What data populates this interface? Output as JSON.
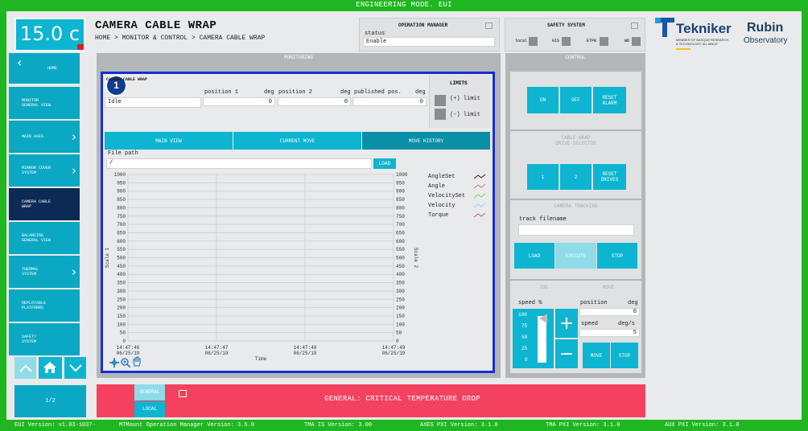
{
  "top_banner": "ENGINEERING MODE. EUI",
  "temperature": "15.0 c",
  "title": "CAMERA CABLE WRAP",
  "breadcrumb": "HOME > MONITOR & CONTROL > CAMERA CABLE WRAP",
  "op_manager": {
    "title": "OPERATION MANAGER",
    "status_label": "status",
    "status_value": "Enable"
  },
  "safety": {
    "title": "SAFETY SYSTEM",
    "items": [
      "local",
      "GIS",
      "ETPB",
      "WD"
    ]
  },
  "logos": {
    "tekniker": "Tekniker",
    "tekniker_sub1": "MEMBER OF BASQUE RESEARCH",
    "tekniker_sub2": "& TECHNOLOGY ALLIANCE",
    "rubin1": "Rubin",
    "rubin2": "Observatory"
  },
  "sidebar": {
    "home": "HOME",
    "items": [
      {
        "label1": "MONITOR",
        "label2": "GENERAL VIEW"
      },
      {
        "label1": "MAIN AXES",
        "label2": ""
      },
      {
        "label1": "MIRROR COVER",
        "label2": "SYSTEM"
      },
      {
        "label1": "CAMERA CABLE",
        "label2": "WRAP"
      },
      {
        "label1": "BALANCING",
        "label2": "GENERAL VIEW"
      },
      {
        "label1": "THERMAL",
        "label2": "SYSTEM"
      },
      {
        "label1": "DEPLOYABLE",
        "label2": "PLATFORMS"
      },
      {
        "label1": "SAFETY",
        "label2": "SYSTEM"
      }
    ],
    "page": "1/2"
  },
  "monitoring": {
    "header": "MONITORING",
    "badge": "1",
    "subtitle": "CAMERA CABLE WRAP",
    "state": "Idle",
    "pos1_label": "position 1",
    "pos1_unit": "deg",
    "pos1_value": "0",
    "pos2_label": "position 2",
    "pos2_unit": "deg",
    "pos2_value": "0",
    "pub_label": "published pos.",
    "pub_unit": "deg",
    "pub_value": "0",
    "limits_title": "LIMITS",
    "limit_plus": "(+) limit",
    "limit_minus": "(-) limit",
    "tabs": [
      "MAIN VIEW",
      "CURRENT MOVE",
      "MOVE HISTORY"
    ],
    "file_path_label": "File path",
    "file_path_value": "/",
    "load": "LOAD"
  },
  "chart_data": {
    "type": "line",
    "xlabel": "Time",
    "ylabel": "Scale 1",
    "ylabel2": "Scale 2",
    "ylim": [
      0,
      1000
    ],
    "yticks": [
      "1000",
      "950",
      "900",
      "850",
      "800",
      "750",
      "700",
      "650",
      "600",
      "550",
      "500",
      "450",
      "400",
      "350",
      "300",
      "250",
      "200",
      "150",
      "100",
      "50",
      "0"
    ],
    "xticks": [
      {
        "time": "14:47:46",
        "date": "06/25/19"
      },
      {
        "time": "14:47:47",
        "date": "06/25/19"
      },
      {
        "time": "14:47:48",
        "date": "06/25/19"
      },
      {
        "time": "14:47:49",
        "date": "06/25/19"
      }
    ],
    "series": [
      {
        "name": "AngleSet",
        "color": "#222222",
        "values": []
      },
      {
        "name": "Angle",
        "color": "#e8707a",
        "values": []
      },
      {
        "name": "VelocitySet",
        "color": "#79d36b",
        "values": []
      },
      {
        "name": "Velocity",
        "color": "#8fd8e6",
        "values": []
      },
      {
        "name": "Torque",
        "color": "#c0607a",
        "values": []
      }
    ],
    "grid": true
  },
  "control": {
    "header": "CONTROL",
    "on": "ON",
    "off": "OFF",
    "reset_alarm": "RESET ALARM",
    "drive_title1": "CABLE WRAP",
    "drive_title2": "DRIVE SELECTOR",
    "d1": "1",
    "d2": "2",
    "reset_drives": "RESET DRIVES",
    "tracking_title": "CAMERA TRACKING",
    "track_label": "track filename",
    "load": "LOAD",
    "execute": "EXECUTE",
    "stop": "STOP",
    "jog": "JOG",
    "move": "MOVE",
    "speed_pct_label": "speed %",
    "speed_ticks": [
      "100",
      "75",
      "50",
      "25",
      "0"
    ],
    "position_label": "position",
    "position_unit": "deg",
    "position_value": "0",
    "speed_label": "speed",
    "speed_unit": "deg/s",
    "speed_value": "5",
    "move_btn": "MOVE",
    "stop_btn": "STOP"
  },
  "alarm": {
    "general": "GENERAL",
    "local": "LOCAL",
    "message": "GENERAL: CRITICAL TEMPERATURE DROP"
  },
  "footer": [
    "EUI Version: v1.03-1037-",
    "MTMount Operation Manager Version: 3.5.0",
    "TMA IS Version: 3.00",
    "AXES PXI Version: 3.1.0",
    "TMA PXI Version: 3.1.0",
    "AUX PXI Version: 3.1.0"
  ],
  "colors": {
    "teal": "#0db5d0",
    "navy": "#0c2a55",
    "alarm": "#f4415f",
    "frame": "#1fb61f",
    "highlight": "#1630d0"
  }
}
